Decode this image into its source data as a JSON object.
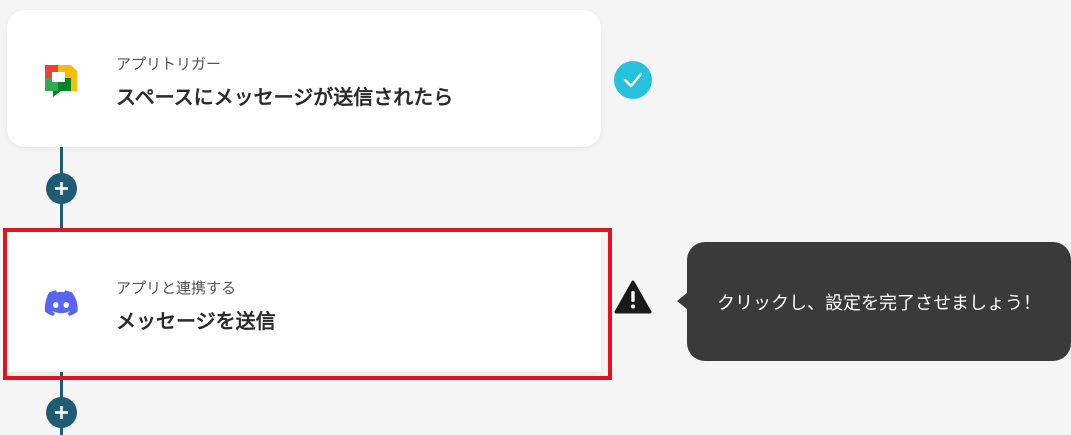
{
  "flow": {
    "trigger": {
      "subtitle": "アプリトリガー",
      "title": "スペースにメッセージが送信されたら",
      "app_icon": "google-chat-icon",
      "status_icon": "check-icon",
      "status_color": "#26c2dc"
    },
    "action": {
      "subtitle": "アプリと連携する",
      "title": "メッセージを送信",
      "app_icon": "discord-icon",
      "app_color": "#5865f2",
      "status_icon": "warning-icon",
      "highlight_color": "#e0131f"
    },
    "add_step_icon": "plus-icon",
    "connector_color": "#1f5c73"
  },
  "tooltip": {
    "text": "クリックし、設定を完了させましょう！"
  }
}
